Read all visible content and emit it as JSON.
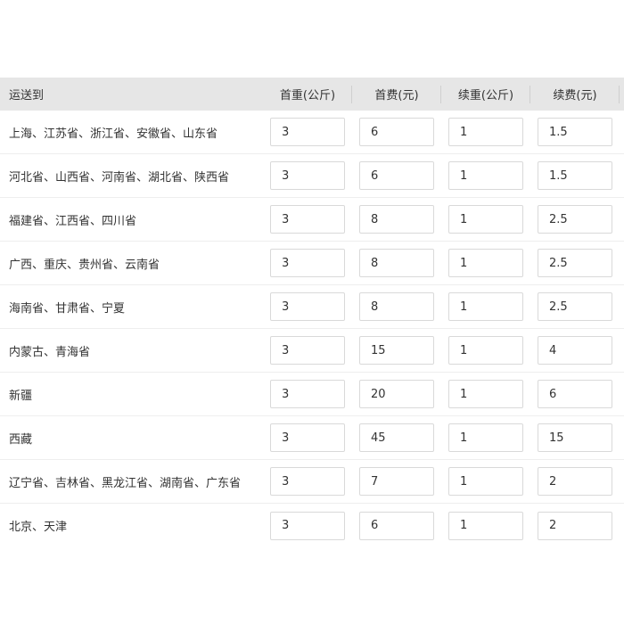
{
  "headers": {
    "destination": "运送到",
    "first_weight": "首重(公斤)",
    "first_fee": "首费(元)",
    "extra_weight": "续重(公斤)",
    "extra_fee": "续费(元)"
  },
  "rows": [
    {
      "region": "上海、江苏省、浙江省、安徽省、山东省",
      "first_weight": "3",
      "first_fee": "6",
      "extra_weight": "1",
      "extra_fee": "1.5"
    },
    {
      "region": "河北省、山西省、河南省、湖北省、陕西省",
      "first_weight": "3",
      "first_fee": "6",
      "extra_weight": "1",
      "extra_fee": "1.5"
    },
    {
      "region": "福建省、江西省、四川省",
      "first_weight": "3",
      "first_fee": "8",
      "extra_weight": "1",
      "extra_fee": "2.5"
    },
    {
      "region": "广西、重庆、贵州省、云南省",
      "first_weight": "3",
      "first_fee": "8",
      "extra_weight": "1",
      "extra_fee": "2.5"
    },
    {
      "region": "海南省、甘肃省、宁夏",
      "first_weight": "3",
      "first_fee": "8",
      "extra_weight": "1",
      "extra_fee": "2.5"
    },
    {
      "region": "内蒙古、青海省",
      "first_weight": "3",
      "first_fee": "15",
      "extra_weight": "1",
      "extra_fee": "4"
    },
    {
      "region": "新疆",
      "first_weight": "3",
      "first_fee": "20",
      "extra_weight": "1",
      "extra_fee": "6"
    },
    {
      "region": "西藏",
      "first_weight": "3",
      "first_fee": "45",
      "extra_weight": "1",
      "extra_fee": "15"
    },
    {
      "region": "辽宁省、吉林省、黑龙江省、湖南省、广东省",
      "first_weight": "3",
      "first_fee": "7",
      "extra_weight": "1",
      "extra_fee": "2"
    },
    {
      "region": "北京、天津",
      "first_weight": "3",
      "first_fee": "6",
      "extra_weight": "1",
      "extra_fee": "2"
    }
  ]
}
